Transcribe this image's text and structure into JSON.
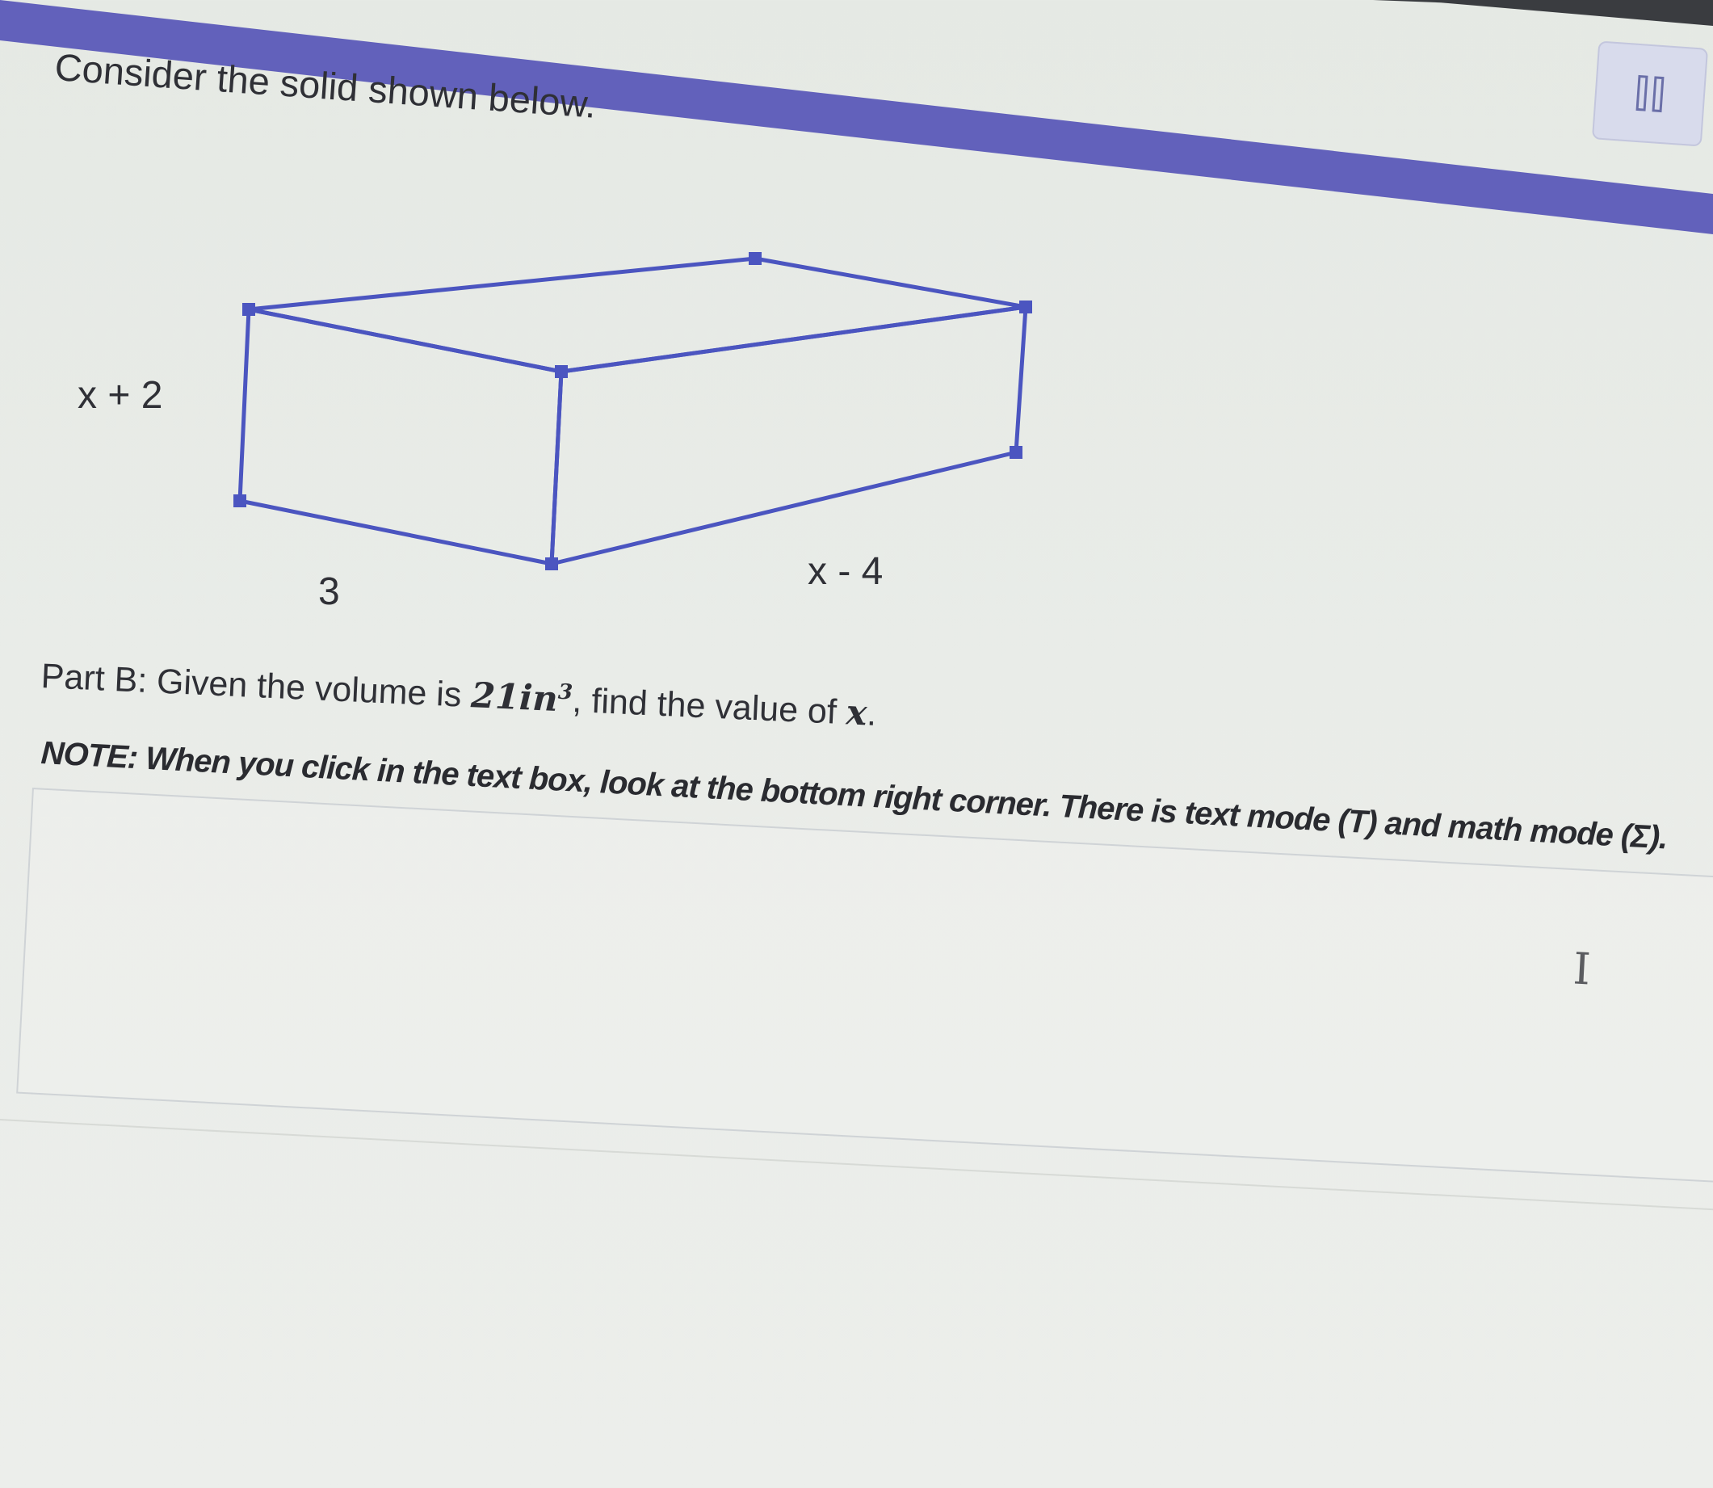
{
  "question": {
    "prompt": "Consider the solid shown below.",
    "pause_button_label": "pause",
    "figure": {
      "height_label": "x + 2",
      "width_label": "3",
      "depth_label": "x - 4"
    },
    "part_b": {
      "lead": "Part B: Given the volume is ",
      "volume_value": "21",
      "volume_unit": "in",
      "volume_exponent": "3",
      "middle": ", find the value of ",
      "variable": "x",
      "end": "."
    },
    "note": "NOTE: When you click in the text box, look at the bottom right corner. There is text mode (T) and math mode (Σ).",
    "answer_value": ""
  },
  "colors": {
    "accent": "#5b5ab8",
    "edge": "#4b55c0",
    "text": "#2f3036"
  },
  "icons": {
    "pause": "pause-icon",
    "cursor": "text-cursor-icon"
  }
}
